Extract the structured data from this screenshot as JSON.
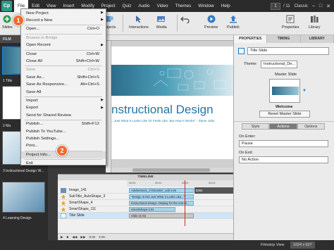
{
  "app": {
    "logo": "Cp"
  },
  "menubar": {
    "items": [
      "File",
      "Edit",
      "View",
      "Insert",
      "Modify",
      "Project",
      "Quiz",
      "Audio",
      "Video",
      "Themes",
      "Window",
      "Help"
    ],
    "page_current": "1",
    "page_total": "/ 11",
    "theme": "Classic"
  },
  "toolbar": {
    "slides_label": "Slides",
    "objects_label": "Objects",
    "interactions_label": "Interactions",
    "media_label": "Media",
    "preview_label": "Preview",
    "publish_label": "Publish",
    "properties_label": "Properties",
    "library_label": "Library"
  },
  "filmstrip": {
    "header": "FILM",
    "captions": [
      "1 Title",
      "2 Ma",
      "3 Instructional Design W...",
      "4 Learning Design"
    ]
  },
  "file_menu": {
    "items": [
      {
        "label": "New Project",
        "shortcut": "",
        "submenu": true,
        "disabled": false
      },
      {
        "label": "Record a New",
        "shortcut": "",
        "submenu": true,
        "disabled": false
      },
      {
        "label": "Open...",
        "shortcut": "Ctrl+O",
        "submenu": false,
        "disabled": false
      },
      {
        "label": "Browse in Bridge",
        "shortcut": "",
        "submenu": false,
        "disabled": true
      },
      {
        "label": "Open Recent",
        "shortcut": "",
        "submenu": true,
        "disabled": false
      },
      {
        "label": "Close",
        "shortcut": "Ctrl+W",
        "submenu": false,
        "disabled": false
      },
      {
        "label": "Close All",
        "shortcut": "Shift+Ctrl+W",
        "submenu": false,
        "disabled": false
      },
      {
        "label": "Save",
        "shortcut": "Ctrl+S",
        "submenu": false,
        "disabled": true
      },
      {
        "label": "Save As...",
        "shortcut": "Shift+Ctrl+S",
        "submenu": false,
        "disabled": false
      },
      {
        "label": "Save As Responsive...",
        "shortcut": "Alt+Ctrl+S",
        "submenu": false,
        "disabled": false
      },
      {
        "label": "Save All",
        "shortcut": "",
        "submenu": false,
        "disabled": false
      },
      {
        "label": "Import",
        "shortcut": "",
        "submenu": true,
        "disabled": false
      },
      {
        "label": "Export",
        "shortcut": "",
        "submenu": true,
        "disabled": false
      },
      {
        "label": "Send for Shared Review",
        "shortcut": "",
        "submenu": false,
        "disabled": false
      },
      {
        "label": "Publish...",
        "shortcut": "Shift+F12",
        "submenu": false,
        "disabled": false
      },
      {
        "label": "Publish To YouTube...",
        "shortcut": "",
        "submenu": false,
        "disabled": false
      },
      {
        "label": "Publish Settings...",
        "shortcut": "",
        "submenu": false,
        "disabled": false
      },
      {
        "label": "Print...",
        "shortcut": "",
        "submenu": false,
        "disabled": false
      },
      {
        "label": "Project Info...",
        "shortcut": "",
        "submenu": false,
        "disabled": false
      },
      {
        "label": "Exit",
        "shortcut": "",
        "submenu": false,
        "disabled": false
      }
    ]
  },
  "callouts": [
    "1",
    "2"
  ],
  "slide": {
    "title": "nstructional Design",
    "quote": "...Just What It Looks Like Or Feels Like, But How It Works\" - Steve Jobs"
  },
  "properties": {
    "tabs": [
      "PROPERTIES",
      "TIMING",
      "LIBRARY"
    ],
    "slide_name": "Title Slide",
    "theme_label": "Theme:",
    "theme_value": "Instructional_De...",
    "master_slide_label": "Master Slide",
    "master_name": "Welcome",
    "reset_button": "Reset Master Slide",
    "subtabs": [
      "Style",
      "Actions",
      "Options"
    ],
    "on_enter_label": "On Enter:",
    "on_enter_value": "Pause",
    "on_exit_label": "On Exit:",
    "on_exit_value": "No Action"
  },
  "timeline": {
    "header": "TIMELINE",
    "ruler_ticks": [
      "00:00",
      "00:01",
      "00:02",
      "00:03"
    ],
    "rows": [
      {
        "name": "Image_141",
        "bar": "AdobeStock_170319467_edit 3.0s"
      },
      {
        "name": "SubTitle_AutoShape_3",
        "bar": "\"Design Is Not Just What It Looks Like...\""
      },
      {
        "name": "SmartShape_4",
        "bar": "Instructional Design :Display for the rest of..."
      },
      {
        "name": "SmartShape_111",
        "bar": "SmartShape:2.0s"
      },
      {
        "name": "Title Slide",
        "bar": "Slide (3.0s)"
      }
    ],
    "end_label": "END",
    "time_readout": "0.0s",
    "duration_readout": "3.0s"
  },
  "statusbar": {
    "view": "Filmstrip View",
    "resolution": "1024 x 627"
  },
  "colors": {
    "accent": "#2a9a86",
    "callout": "#f06a2c",
    "slide_title": "#2276a6",
    "selection": "#1e7ac8"
  }
}
